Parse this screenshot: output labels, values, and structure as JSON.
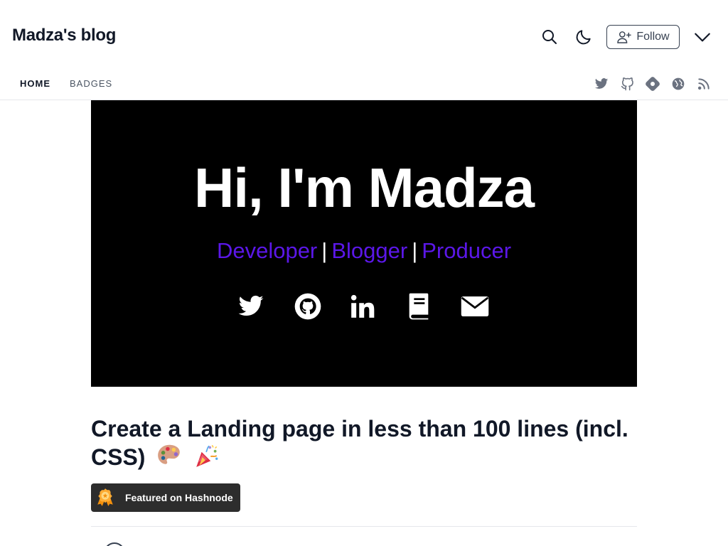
{
  "header": {
    "blog_title": "Madza's blog",
    "follow_label": "Follow"
  },
  "nav": {
    "items": [
      {
        "label": "HOME",
        "active": true
      },
      {
        "label": "BADGES",
        "active": false
      }
    ],
    "social_icons": [
      "twitter-icon",
      "github-icon",
      "hashnode-icon",
      "globe-icon",
      "rss-icon"
    ]
  },
  "banner": {
    "title": "Hi, I'm Madza",
    "roles": [
      "Developer",
      "Blogger",
      "Producer"
    ],
    "separator": "|",
    "icons": [
      "twitter-icon",
      "github-icon",
      "linkedin-icon",
      "book-icon",
      "mail-icon"
    ]
  },
  "article": {
    "title": "Create a Landing page in less than 100 lines (incl. CSS)",
    "title_emojis": [
      "palette-emoji",
      "party-popper-emoji"
    ],
    "featured_label": "Featured on Hashnode"
  },
  "colors": {
    "banner_bg": "#000000",
    "role_accent": "#5b17e8",
    "text_dark": "#111827",
    "icon_gray": "#6b7280",
    "featured_bg": "#2d2d2d"
  }
}
